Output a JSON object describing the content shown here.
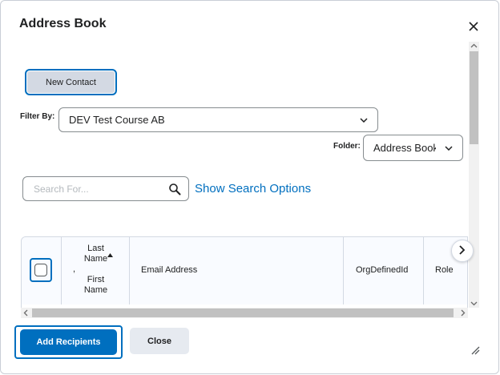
{
  "dialog": {
    "title": "Address Book",
    "new_contact_label": "New Contact",
    "filter_label": "Filter By:",
    "filter_value": "DEV Test Course AB",
    "folder_label": "Folder:",
    "folder_value": "Address Book",
    "search_placeholder": "Search For...",
    "search_options_label": "Show Search Options",
    "table": {
      "headers": {
        "last_name": "Last Name",
        "separator": ",",
        "first_name": "First Name",
        "email": "Email Address",
        "org_defined_id": "OrgDefinedId",
        "role": "Role"
      }
    },
    "add_recipients_label": "Add Recipients",
    "close_label": "Close"
  },
  "icons": [
    "close-icon",
    "chevron-down-icon",
    "search-icon",
    "sort-ascending-icon",
    "chevron-right-icon",
    "resize-grip-icon"
  ],
  "colors": {
    "accent": "#006fbf",
    "button_secondary": "#e6eaf0",
    "focus_ring": "#006fbf"
  }
}
